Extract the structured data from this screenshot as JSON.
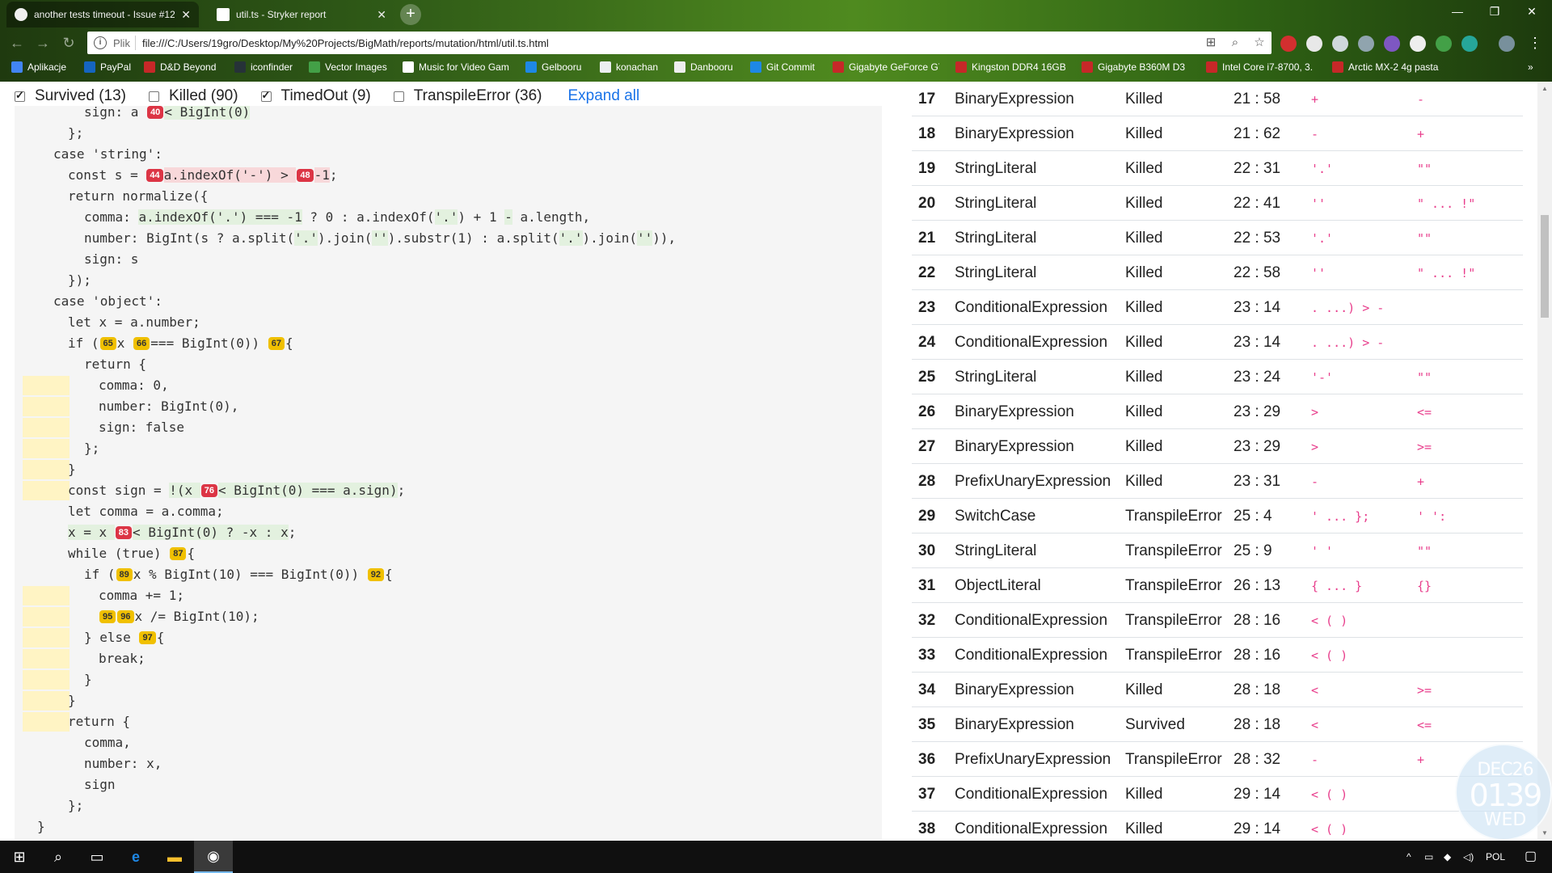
{
  "browser": {
    "tabs": [
      {
        "title": "another tests timeout - Issue #12",
        "active": true
      },
      {
        "title": "util.ts - Stryker report",
        "active": false
      }
    ],
    "address": {
      "scheme": "Plik",
      "url": "file:///C:/Users/19gro/Desktop/My%20Projects/BigMath/reports/mutation/html/util.ts.html"
    },
    "bookmarks": [
      "Aplikacje",
      "PayPal",
      "D&D Beyond",
      "iconfinder",
      "Vector Images",
      "Music for Video Gam",
      "Gelbooru",
      "konachan",
      "Danbooru",
      "Git Commit",
      "Gigabyte GeForce GT",
      "Kingston DDR4 16GB",
      "Gigabyte B360M D3",
      "Intel Core i7-8700, 3.",
      "Arctic MX-2 4g pasta"
    ]
  },
  "filters": [
    {
      "label": "Survived (13)",
      "checked": true
    },
    {
      "label": "Killed (90)",
      "checked": false
    },
    {
      "label": "TimedOut (9)",
      "checked": true
    },
    {
      "label": "TranspileError (36)",
      "checked": false
    }
  ],
  "expand_all": "Expand all",
  "code": {
    "b40": "40",
    "b44": "44",
    "b48": "48",
    "b65": "65",
    "b66": "66",
    "b67": "67",
    "b76": "76",
    "b83": "83",
    "b87": "87",
    "b89": "89",
    "b92": "92",
    "b95": "95",
    "b96": "96",
    "b97": "97"
  },
  "mutants": [
    {
      "id": "17",
      "mutator": "BinaryExpression",
      "status": "Killed",
      "loc": "21 : 58",
      "orig": "+",
      "repl": "-"
    },
    {
      "id": "18",
      "mutator": "BinaryExpression",
      "status": "Killed",
      "loc": "21 : 62",
      "orig": "-",
      "repl": "+"
    },
    {
      "id": "19",
      "mutator": "StringLiteral",
      "status": "Killed",
      "loc": "22 : 31",
      "orig": "'.'",
      "repl": "\"\""
    },
    {
      "id": "20",
      "mutator": "StringLiteral",
      "status": "Killed",
      "loc": "22 : 41",
      "orig": "''",
      "repl": "\" ... !\""
    },
    {
      "id": "21",
      "mutator": "StringLiteral",
      "status": "Killed",
      "loc": "22 : 53",
      "orig": "'.'",
      "repl": "\"\""
    },
    {
      "id": "22",
      "mutator": "StringLiteral",
      "status": "Killed",
      "loc": "22 : 58",
      "orig": "''",
      "repl": "\" ... !\""
    },
    {
      "id": "23",
      "mutator": "ConditionalExpression",
      "status": "Killed",
      "loc": "23 : 14",
      "orig": ". ...) > -",
      "repl": ""
    },
    {
      "id": "24",
      "mutator": "ConditionalExpression",
      "status": "Killed",
      "loc": "23 : 14",
      "orig": ". ...) > -",
      "repl": ""
    },
    {
      "id": "25",
      "mutator": "StringLiteral",
      "status": "Killed",
      "loc": "23 : 24",
      "orig": "'-'",
      "repl": "\"\""
    },
    {
      "id": "26",
      "mutator": "BinaryExpression",
      "status": "Killed",
      "loc": "23 : 29",
      "orig": ">",
      "repl": "<="
    },
    {
      "id": "27",
      "mutator": "BinaryExpression",
      "status": "Killed",
      "loc": "23 : 29",
      "orig": ">",
      "repl": ">="
    },
    {
      "id": "28",
      "mutator": "PrefixUnaryExpression",
      "status": "Killed",
      "loc": "23 : 31",
      "orig": "-",
      "repl": "+"
    },
    {
      "id": "29",
      "mutator": "SwitchCase",
      "status": "TranspileError",
      "loc": "25 : 4",
      "orig": "' ... };",
      "repl": "' ':"
    },
    {
      "id": "30",
      "mutator": "StringLiteral",
      "status": "TranspileError",
      "loc": "25 : 9",
      "orig": "' '",
      "repl": "\"\""
    },
    {
      "id": "31",
      "mutator": "ObjectLiteral",
      "status": "TranspileError",
      "loc": "26 : 13",
      "orig": "{ ... }",
      "repl": "{}"
    },
    {
      "id": "32",
      "mutator": "ConditionalExpression",
      "status": "TranspileError",
      "loc": "28 : 16",
      "orig": "< ( )",
      "repl": ""
    },
    {
      "id": "33",
      "mutator": "ConditionalExpression",
      "status": "TranspileError",
      "loc": "28 : 16",
      "orig": "< ( )",
      "repl": ""
    },
    {
      "id": "34",
      "mutator": "BinaryExpression",
      "status": "Killed",
      "loc": "28 : 18",
      "orig": "<",
      "repl": ">="
    },
    {
      "id": "35",
      "mutator": "BinaryExpression",
      "status": "Survived",
      "loc": "28 : 18",
      "orig": "<",
      "repl": "<="
    },
    {
      "id": "36",
      "mutator": "PrefixUnaryExpression",
      "status": "TranspileError",
      "loc": "28 : 32",
      "orig": "-",
      "repl": "+"
    },
    {
      "id": "37",
      "mutator": "ConditionalExpression",
      "status": "Killed",
      "loc": "29 : 14",
      "orig": "< ( )",
      "repl": ""
    },
    {
      "id": "38",
      "mutator": "ConditionalExpression",
      "status": "Killed",
      "loc": "29 : 14",
      "orig": "< ( )",
      "repl": ""
    }
  ],
  "clock_widget": {
    "date": "DEC26",
    "time": "0139",
    "day": "WED"
  },
  "taskbar": {
    "lang": "POL"
  }
}
